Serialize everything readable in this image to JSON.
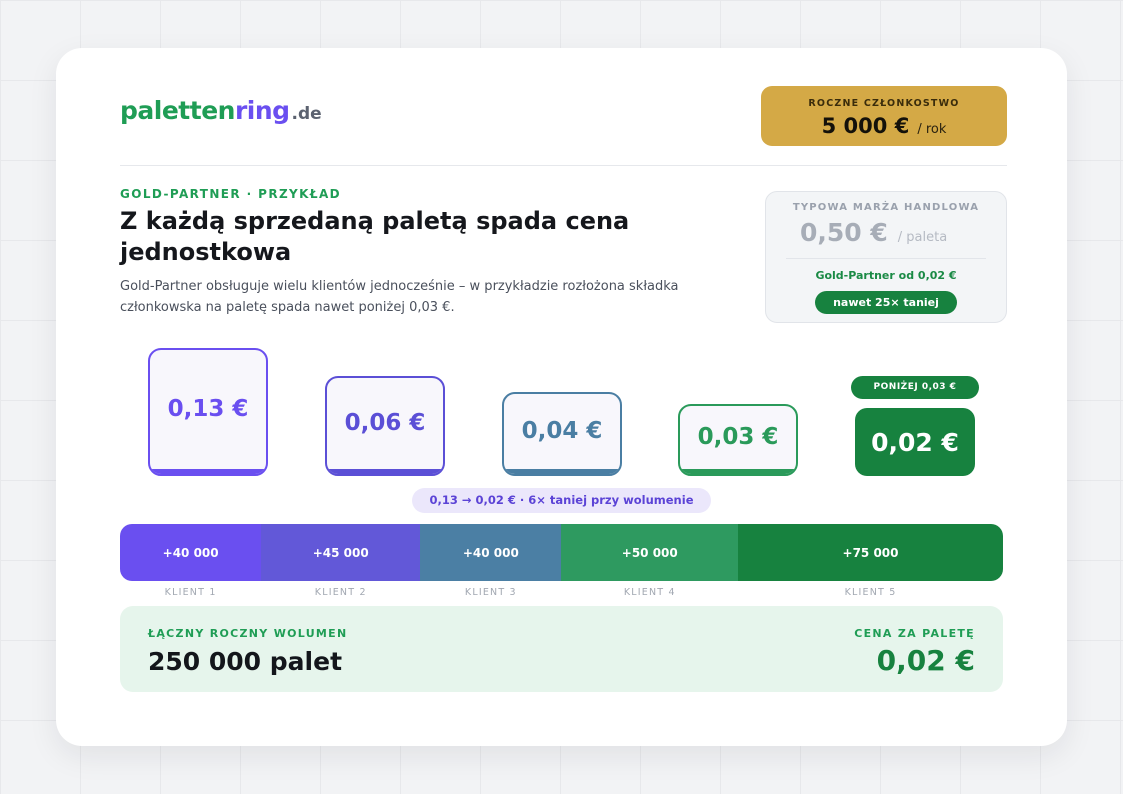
{
  "logo": {
    "part1": "paletten",
    "part2": "ring",
    "part3": ".de"
  },
  "membership": {
    "label": "ROCZNE CZŁONKOSTWO",
    "value": "5 000 €",
    "unit": "/ rok"
  },
  "intro": {
    "eyebrow": "GOLD-PARTNER · PRZYKŁAD",
    "headline": "Z każdą sprzedaną paletą spada cena jednostkowa",
    "subtext": "Gold-Partner obsługuje wielu klientów jednocześnie – w przykładzie rozłożona składka członkowska na paletę spada nawet poniżej 0,03 €."
  },
  "margin": {
    "label": "TYPOWA MARŻA HANDLOWA",
    "value": "0,50 €",
    "unit": "/ paleta",
    "gold_text": "Gold-Partner od 0,02 €",
    "pill": "nawet 25× taniej"
  },
  "prices": [
    {
      "value": "0,13 €",
      "color": "#6a4ff0"
    },
    {
      "value": "0,06 €",
      "color": "#5b4fd6"
    },
    {
      "value": "0,04 €",
      "color": "#4a7ea3"
    },
    {
      "value": "0,03 €",
      "color": "#2a9a5a"
    }
  ],
  "highlight": {
    "tag": "PONIŻEJ 0,03 €",
    "value": "0,02 €",
    "color": "#17823f"
  },
  "comparison": "0,13 → 0,02 € · 6× taniej przy wolumenie",
  "volume": {
    "segments": [
      {
        "label": "+40 000",
        "client": "KLIENT 1",
        "value": 40000,
        "color": "#6a4ff0"
      },
      {
        "label": "+45 000",
        "client": "KLIENT 2",
        "value": 45000,
        "color": "#6258d8"
      },
      {
        "label": "+40 000",
        "client": "KLIENT 3",
        "value": 40000,
        "color": "#4b7fa4"
      },
      {
        "label": "+50 000",
        "client": "KLIENT 4",
        "value": 50000,
        "color": "#2e9a60"
      },
      {
        "label": "+75 000",
        "client": "KLIENT 5",
        "value": 75000,
        "color": "#17823f"
      }
    ]
  },
  "total": {
    "left_label": "ŁĄCZNY ROCZNY WOLUMEN",
    "left_value": "250 000 palet",
    "right_label": "CENA ZA PALETĘ",
    "right_value": "0,02 €"
  }
}
